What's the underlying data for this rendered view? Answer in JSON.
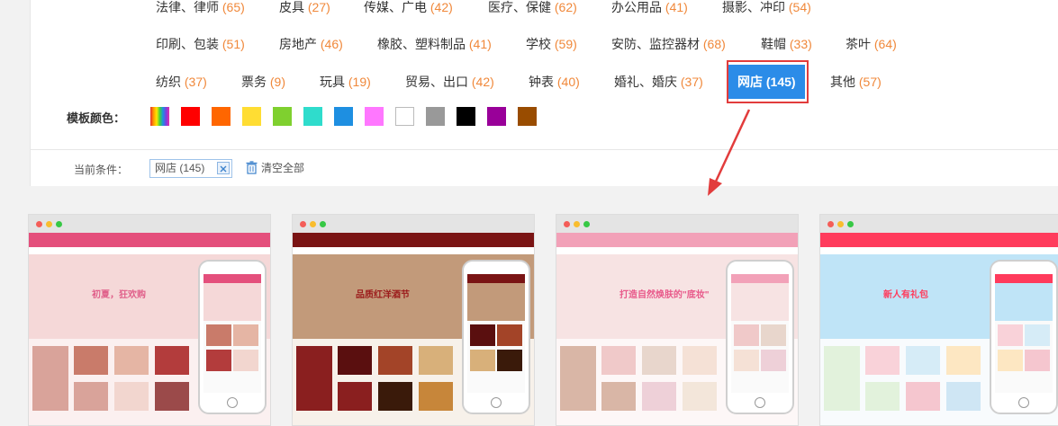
{
  "categories": [
    [
      {
        "name": "法律、律师",
        "count": "(65)"
      },
      {
        "name": "皮具",
        "count": "(27)"
      },
      {
        "name": "传媒、广电",
        "count": "(42)"
      },
      {
        "name": "医疗、保健",
        "count": "(62)"
      },
      {
        "name": "办公用品",
        "count": "(41)"
      },
      {
        "name": "摄影、冲印",
        "count": "(54)"
      }
    ],
    [
      {
        "name": "印刷、包装",
        "count": "(51)"
      },
      {
        "name": "房地产",
        "count": "(46)"
      },
      {
        "name": "橡胶、塑料制品",
        "count": "(41)"
      },
      {
        "name": "学校",
        "count": "(59)"
      },
      {
        "name": "安防、监控器材",
        "count": "(68)"
      },
      {
        "name": "鞋帽",
        "count": "(33)"
      },
      {
        "name": "茶叶",
        "count": "(64)"
      }
    ],
    [
      {
        "name": "纺织",
        "count": "(37)"
      },
      {
        "name": "票务",
        "count": "(9)"
      },
      {
        "name": "玩具",
        "count": "(19)"
      },
      {
        "name": "贸易、出口",
        "count": "(42)"
      },
      {
        "name": "钟表",
        "count": "(40)"
      },
      {
        "name": "婚礼、婚庆",
        "count": "(37)"
      },
      {
        "name": "网店",
        "count": "(145)",
        "active": true
      },
      {
        "name": "其他",
        "count": "(57)"
      }
    ]
  ],
  "color_filter": {
    "label": "模板颜色：",
    "swatches": [
      "rainbow",
      "#ff0000",
      "#ff6600",
      "#ffdd33",
      "#7fd02f",
      "#2fdccc",
      "#1e8fe1",
      "#ff77ff",
      "#ffffff",
      "#999999",
      "#000000",
      "#990099",
      "#994c00"
    ]
  },
  "conditions": {
    "label": "当前条件：",
    "tag": "网店 (145)",
    "clear": "清空全部"
  },
  "cards": [
    {
      "theme": "shoes",
      "hero": "初夏，狂欢购",
      "accent": "#e0608a"
    },
    {
      "theme": "wine",
      "hero": "品质红洋酒节",
      "accent": "#9b1b1b"
    },
    {
      "theme": "cosmetics",
      "hero": "打造自然焕肤的\"底妆\"",
      "accent": "#e8598a"
    },
    {
      "theme": "baby",
      "hero": "新人有礼包",
      "accent": "#ff3b5c"
    }
  ]
}
